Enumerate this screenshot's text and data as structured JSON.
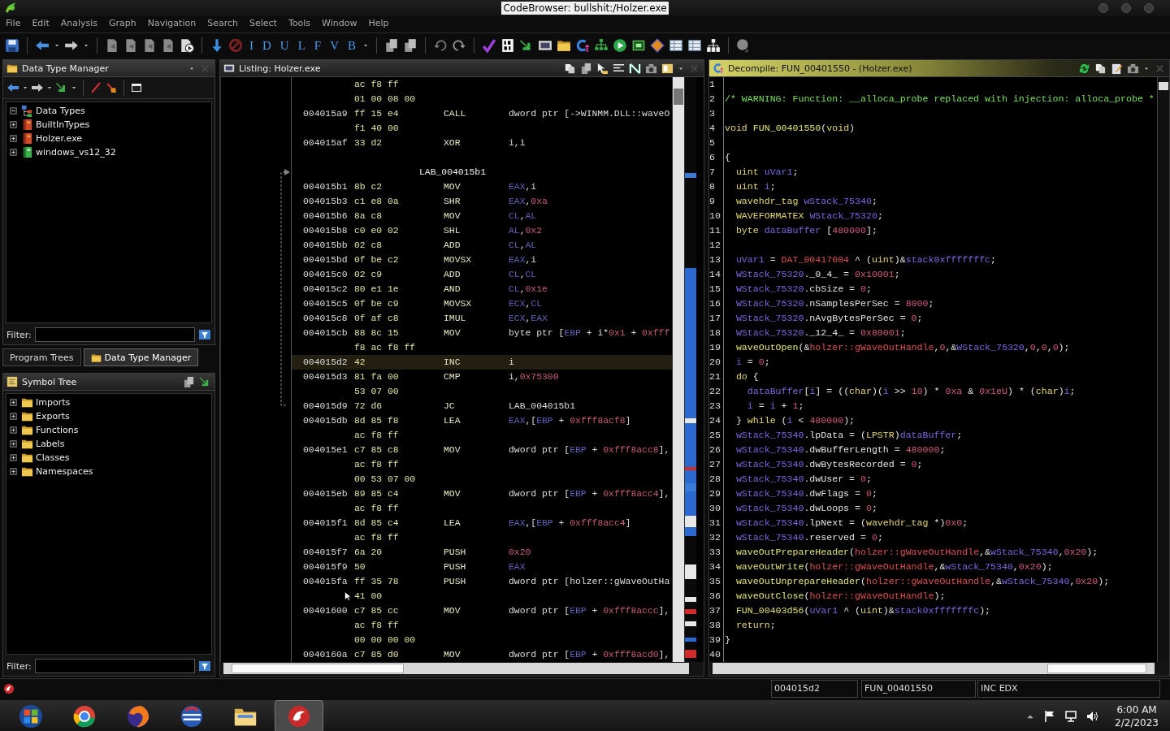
{
  "window": {
    "title": "CodeBrowser: bullshit:/Holzer.exe"
  },
  "menu": [
    "File",
    "Edit",
    "Analysis",
    "Graph",
    "Navigation",
    "Search",
    "Select",
    "Tools",
    "Window",
    "Help"
  ],
  "toolbar": {
    "letters": [
      "I",
      "D",
      "U",
      "L",
      "F",
      "V",
      "B"
    ]
  },
  "data_type_manager": {
    "title": "Data Type Manager",
    "filter_label": "Filter:",
    "tree": [
      {
        "label": "Data Types",
        "expanded": true,
        "children": [
          {
            "label": "BuiltInTypes",
            "expanded": false
          },
          {
            "label": "Holzer.exe",
            "expanded": false
          },
          {
            "label": "windows_vs12_32",
            "expanded": false
          }
        ]
      }
    ]
  },
  "left_tabs": [
    {
      "label": "Program Trees",
      "selected": false
    },
    {
      "label": "Data Type Manager",
      "selected": true
    }
  ],
  "symbol_tree": {
    "title": "Symbol Tree",
    "filter_label": "Filter:",
    "items": [
      {
        "label": "Imports",
        "expanded": false
      },
      {
        "label": "Exports",
        "expanded": false
      },
      {
        "label": "Functions",
        "expanded": false
      },
      {
        "label": "Labels",
        "expanded": false
      },
      {
        "label": "Classes",
        "expanded": false
      },
      {
        "label": "Namespaces",
        "expanded": false
      }
    ]
  },
  "listing": {
    "title": "Listing:  Holzer.exe",
    "rows": [
      {
        "kind": "code",
        "bytes": "ac f8 ff",
        "selected": false
      },
      {
        "kind": "code",
        "bytes": "01 00 08 00",
        "selected": false
      },
      {
        "kind": "code",
        "address": "004015a9",
        "bytes": "ff 15 e4",
        "mnemonic": "CALL",
        "operands": [
          {
            "text": "dword ptr [->WINMM.DLL::waveO",
            "kind": "plain"
          }
        ],
        "selected": false
      },
      {
        "kind": "code",
        "bytes": "f1 40 00",
        "selected": false
      },
      {
        "kind": "code",
        "address": "004015af",
        "bytes": "33 d2",
        "mnemonic": "XOR",
        "operands": [
          {
            "text": "i,i",
            "kind": "plain"
          }
        ],
        "selected": false
      },
      {
        "kind": "blank",
        "selected": false
      },
      {
        "kind": "label",
        "label": "LAB_004015b1",
        "selected": false
      },
      {
        "kind": "code",
        "address": "004015b1",
        "bytes": "8b c2",
        "mnemonic": "MOV",
        "operands": [
          {
            "text": "EAX",
            "kind": "register"
          },
          {
            "text": ",i",
            "kind": "plain"
          }
        ],
        "selected": false
      },
      {
        "kind": "code",
        "address": "004015b3",
        "bytes": "c1 e8 0a",
        "mnemonic": "SHR",
        "operands": [
          {
            "text": "EAX",
            "kind": "register"
          },
          {
            "text": ",",
            "kind": "plain"
          },
          {
            "text": "0xa",
            "kind": "number"
          }
        ],
        "selected": false
      },
      {
        "kind": "code",
        "address": "004015b6",
        "bytes": "8a c8",
        "mnemonic": "MOV",
        "operands": [
          {
            "text": "CL",
            "kind": "register"
          },
          {
            "text": ",",
            "kind": "plain"
          },
          {
            "text": "AL",
            "kind": "register"
          }
        ],
        "selected": false
      },
      {
        "kind": "code",
        "address": "004015b8",
        "bytes": "c0 e0 02",
        "mnemonic": "SHL",
        "operands": [
          {
            "text": "AL",
            "kind": "register"
          },
          {
            "text": ",",
            "kind": "plain"
          },
          {
            "text": "0x2",
            "kind": "number"
          }
        ],
        "selected": false
      },
      {
        "kind": "code",
        "address": "004015bb",
        "bytes": "02 c8",
        "mnemonic": "ADD",
        "operands": [
          {
            "text": "CL",
            "kind": "register"
          },
          {
            "text": ",",
            "kind": "plain"
          },
          {
            "text": "AL",
            "kind": "register"
          }
        ],
        "selected": false
      },
      {
        "kind": "code",
        "address": "004015bd",
        "bytes": "0f be c2",
        "mnemonic": "MOVSX",
        "operands": [
          {
            "text": "EAX",
            "kind": "register"
          },
          {
            "text": ",i",
            "kind": "plain"
          }
        ],
        "selected": false
      },
      {
        "kind": "code",
        "address": "004015c0",
        "bytes": "02 c9",
        "mnemonic": "ADD",
        "operands": [
          {
            "text": "CL",
            "kind": "register"
          },
          {
            "text": ",",
            "kind": "plain"
          },
          {
            "text": "CL",
            "kind": "register"
          }
        ],
        "selected": false
      },
      {
        "kind": "code",
        "address": "004015c2",
        "bytes": "80 e1 1e",
        "mnemonic": "AND",
        "operands": [
          {
            "text": "CL",
            "kind": "register"
          },
          {
            "text": ",",
            "kind": "plain"
          },
          {
            "text": "0x1e",
            "kind": "number"
          }
        ],
        "selected": false
      },
      {
        "kind": "code",
        "address": "004015c5",
        "bytes": "0f be c9",
        "mnemonic": "MOVSX",
        "operands": [
          {
            "text": "ECX",
            "kind": "register"
          },
          {
            "text": ",",
            "kind": "plain"
          },
          {
            "text": "CL",
            "kind": "register"
          }
        ],
        "selected": false
      },
      {
        "kind": "code",
        "address": "004015c8",
        "bytes": "0f af c8",
        "mnemonic": "IMUL",
        "operands": [
          {
            "text": "ECX",
            "kind": "register"
          },
          {
            "text": ",",
            "kind": "plain"
          },
          {
            "text": "EAX",
            "kind": "register"
          }
        ],
        "selected": false
      },
      {
        "kind": "code",
        "address": "004015cb",
        "bytes": "88 8c 15",
        "mnemonic": "MOV",
        "operands": [
          {
            "text": "byte ptr [",
            "kind": "plain"
          },
          {
            "text": "EBP",
            "kind": "register"
          },
          {
            "text": " + i*",
            "kind": "plain"
          },
          {
            "text": "0x1",
            "kind": "number"
          },
          {
            "text": " + ",
            "kind": "plain"
          },
          {
            "text": "0xfff",
            "kind": "number"
          }
        ],
        "selected": false
      },
      {
        "kind": "code",
        "bytes": "f8 ac f8 ff",
        "selected": false
      },
      {
        "kind": "code",
        "address": "004015d2",
        "bytes": "42",
        "mnemonic": "INC",
        "operands": [
          {
            "text": "i",
            "kind": "plain"
          }
        ],
        "selected": true
      },
      {
        "kind": "code",
        "address": "004015d3",
        "bytes": "81 fa 00",
        "mnemonic": "CMP",
        "operands": [
          {
            "text": "i,",
            "kind": "plain"
          },
          {
            "text": "0x75300",
            "kind": "number"
          }
        ],
        "selected": false
      },
      {
        "kind": "code",
        "bytes": "53 07 00",
        "selected": false
      },
      {
        "kind": "code",
        "address": "004015d9",
        "bytes": "72 d6",
        "mnemonic": "JC",
        "operands": [
          {
            "text": "LAB_004015b1",
            "kind": "plain"
          }
        ],
        "selected": false
      },
      {
        "kind": "code",
        "address": "004015db",
        "bytes": "8d 85 f8",
        "mnemonic": "LEA",
        "operands": [
          {
            "text": "EAX",
            "kind": "register"
          },
          {
            "text": ",[",
            "kind": "plain"
          },
          {
            "text": "EBP",
            "kind": "register"
          },
          {
            "text": " + ",
            "kind": "plain"
          },
          {
            "text": "0xfff8acf8",
            "kind": "number"
          },
          {
            "text": "]",
            "kind": "plain"
          }
        ],
        "selected": false
      },
      {
        "kind": "code",
        "bytes": "ac f8 ff",
        "selected": false
      },
      {
        "kind": "code",
        "address": "004015e1",
        "bytes": "c7 85 c8",
        "mnemonic": "MOV",
        "operands": [
          {
            "text": "dword ptr [",
            "kind": "plain"
          },
          {
            "text": "EBP",
            "kind": "register"
          },
          {
            "text": " + ",
            "kind": "plain"
          },
          {
            "text": "0xfff8acc8",
            "kind": "number"
          },
          {
            "text": "],",
            "kind": "plain"
          }
        ],
        "selected": false
      },
      {
        "kind": "code",
        "bytes": "ac f8 ff",
        "selected": false
      },
      {
        "kind": "code",
        "bytes": "00 53 07 00",
        "selected": false
      },
      {
        "kind": "code",
        "address": "004015eb",
        "bytes": "89 85 c4",
        "mnemonic": "MOV",
        "operands": [
          {
            "text": "dword ptr [",
            "kind": "plain"
          },
          {
            "text": "EBP",
            "kind": "register"
          },
          {
            "text": " + ",
            "kind": "plain"
          },
          {
            "text": "0xfff8acc4",
            "kind": "number"
          },
          {
            "text": "],",
            "kind": "plain"
          }
        ],
        "selected": false
      },
      {
        "kind": "code",
        "bytes": "ac f8 ff",
        "selected": false
      },
      {
        "kind": "code",
        "address": "004015f1",
        "bytes": "8d 85 c4",
        "mnemonic": "LEA",
        "operands": [
          {
            "text": "EAX",
            "kind": "register"
          },
          {
            "text": ",[",
            "kind": "plain"
          },
          {
            "text": "EBP",
            "kind": "register"
          },
          {
            "text": " + ",
            "kind": "plain"
          },
          {
            "text": "0xfff8acc4",
            "kind": "number"
          },
          {
            "text": "]",
            "kind": "plain"
          }
        ],
        "selected": false
      },
      {
        "kind": "code",
        "bytes": "ac f8 ff",
        "selected": false
      },
      {
        "kind": "code",
        "address": "004015f7",
        "bytes": "6a 20",
        "mnemonic": "PUSH",
        "operands": [
          {
            "text": "0x20",
            "kind": "number"
          }
        ],
        "selected": false
      },
      {
        "kind": "code",
        "address": "004015f9",
        "bytes": "50",
        "mnemonic": "PUSH",
        "operands": [
          {
            "text": "EAX",
            "kind": "register"
          }
        ],
        "selected": false
      },
      {
        "kind": "code",
        "address": "004015fa",
        "bytes": "ff 35 78",
        "mnemonic": "PUSH",
        "operands": [
          {
            "text": "dword ptr [holzer::gWaveOutHa",
            "kind": "plain"
          }
        ],
        "selected": false
      },
      {
        "kind": "code",
        "bytes": "41 00",
        "selected": false
      },
      {
        "kind": "code",
        "address": "00401600",
        "bytes": "c7 85 cc",
        "mnemonic": "MOV",
        "operands": [
          {
            "text": "dword ptr [",
            "kind": "plain"
          },
          {
            "text": "EBP",
            "kind": "register"
          },
          {
            "text": " + ",
            "kind": "plain"
          },
          {
            "text": "0xfff8accc",
            "kind": "number"
          },
          {
            "text": "],",
            "kind": "plain"
          }
        ],
        "selected": false
      },
      {
        "kind": "code",
        "bytes": "ac f8 ff",
        "selected": false
      },
      {
        "kind": "code",
        "bytes": "00 00 00 00",
        "selected": false
      },
      {
        "kind": "code",
        "address": "0040160a",
        "bytes": "c7 85 d0",
        "mnemonic": "MOV",
        "operands": [
          {
            "text": "dword ptr [",
            "kind": "plain"
          },
          {
            "text": "EBP",
            "kind": "register"
          },
          {
            "text": " + ",
            "kind": "plain"
          },
          {
            "text": "0xfff8acd0",
            "kind": "number"
          },
          {
            "text": "],",
            "kind": "plain"
          }
        ],
        "selected": false
      }
    ]
  },
  "decompiler": {
    "title": "Decompile: FUN_00401550 -  (Holzer.exe)",
    "lines": [
      {
        "no": "1"
      },
      {
        "no": "2",
        "code": [
          {
            "text": "/* WARNING: Function: __alloca_probe replaced with injection: alloca_probe *",
            "kind": "comment"
          }
        ]
      },
      {
        "no": "3"
      },
      {
        "no": "4",
        "code": [
          {
            "text": "void ",
            "kind": "type"
          },
          {
            "text": "FUN_00401550",
            "kind": "function"
          },
          {
            "text": "(",
            "kind": "plain"
          },
          {
            "text": "void",
            "kind": "type"
          },
          {
            "text": ")",
            "kind": "plain"
          }
        ]
      },
      {
        "no": "5"
      },
      {
        "no": "6",
        "code": [
          {
            "text": "{",
            "kind": "plain"
          }
        ]
      },
      {
        "no": "7",
        "code": [
          {
            "text": "  uint ",
            "kind": "type"
          },
          {
            "text": "uVar1",
            "kind": "variable"
          },
          {
            "text": ";",
            "kind": "plain"
          }
        ]
      },
      {
        "no": "8",
        "code": [
          {
            "text": "  uint ",
            "kind": "type"
          },
          {
            "text": "i",
            "kind": "variable"
          },
          {
            "text": ";",
            "kind": "plain"
          }
        ]
      },
      {
        "no": "9",
        "code": [
          {
            "text": "  wavehdr_tag ",
            "kind": "type"
          },
          {
            "text": "wStack_75340",
            "kind": "variable"
          },
          {
            "text": ";",
            "kind": "plain"
          }
        ]
      },
      {
        "no": "10",
        "code": [
          {
            "text": "  WAVEFORMATEX ",
            "kind": "type"
          },
          {
            "text": "WStack_75320",
            "kind": "variable"
          },
          {
            "text": ";",
            "kind": "plain"
          }
        ]
      },
      {
        "no": "11",
        "code": [
          {
            "text": "  byte ",
            "kind": "type"
          },
          {
            "text": "dataBuffer",
            "kind": "variable"
          },
          {
            "text": " [",
            "kind": "plain"
          },
          {
            "text": "480000",
            "kind": "number"
          },
          {
            "text": "];",
            "kind": "plain"
          }
        ]
      },
      {
        "no": "12"
      },
      {
        "no": "13",
        "code": [
          {
            "text": "  uVar1",
            "kind": "variable"
          },
          {
            "text": " = ",
            "kind": "plain"
          },
          {
            "text": "DAT_00417004",
            "kind": "global"
          },
          {
            "text": " ^ (",
            "kind": "plain"
          },
          {
            "text": "uint",
            "kind": "type"
          },
          {
            "text": ")&",
            "kind": "plain"
          },
          {
            "text": "stack0xfffffffc",
            "kind": "variable"
          },
          {
            "text": ";",
            "kind": "plain"
          }
        ]
      },
      {
        "no": "14",
        "code": [
          {
            "text": "  WStack_75320",
            "kind": "variable"
          },
          {
            "text": "._0_4_ = ",
            "kind": "plain"
          },
          {
            "text": "0x10001",
            "kind": "number"
          },
          {
            "text": ";",
            "kind": "plain"
          }
        ]
      },
      {
        "no": "15",
        "code": [
          {
            "text": "  WStack_75320",
            "kind": "variable"
          },
          {
            "text": ".cbSize = ",
            "kind": "plain"
          },
          {
            "text": "0",
            "kind": "number"
          },
          {
            "text": ";",
            "kind": "plain"
          }
        ]
      },
      {
        "no": "16",
        "code": [
          {
            "text": "  WStack_75320",
            "kind": "variable"
          },
          {
            "text": ".nSamplesPerSec = ",
            "kind": "plain"
          },
          {
            "text": "8000",
            "kind": "number"
          },
          {
            "text": ";",
            "kind": "plain"
          }
        ]
      },
      {
        "no": "17",
        "code": [
          {
            "text": "  WStack_75320",
            "kind": "variable"
          },
          {
            "text": ".nAvgBytesPerSec = ",
            "kind": "plain"
          },
          {
            "text": "0",
            "kind": "number"
          },
          {
            "text": ";",
            "kind": "plain"
          }
        ]
      },
      {
        "no": "18",
        "code": [
          {
            "text": "  WStack_75320",
            "kind": "variable"
          },
          {
            "text": "._12_4_ = ",
            "kind": "plain"
          },
          {
            "text": "0x80001",
            "kind": "number"
          },
          {
            "text": ";",
            "kind": "plain"
          }
        ]
      },
      {
        "no": "19",
        "code": [
          {
            "text": "  waveOutOpen",
            "kind": "function"
          },
          {
            "text": "(&",
            "kind": "plain"
          },
          {
            "text": "holzer::gWaveOutHandle",
            "kind": "global"
          },
          {
            "text": ",",
            "kind": "plain"
          },
          {
            "text": "0",
            "kind": "number"
          },
          {
            "text": ",&",
            "kind": "plain"
          },
          {
            "text": "WStack_75320",
            "kind": "variable"
          },
          {
            "text": ",",
            "kind": "plain"
          },
          {
            "text": "0",
            "kind": "number"
          },
          {
            "text": ",",
            "kind": "plain"
          },
          {
            "text": "0",
            "kind": "number"
          },
          {
            "text": ",",
            "kind": "plain"
          },
          {
            "text": "0",
            "kind": "number"
          },
          {
            "text": ");",
            "kind": "plain"
          }
        ]
      },
      {
        "no": "20",
        "code": [
          {
            "text": "  i",
            "kind": "variable"
          },
          {
            "text": " = ",
            "kind": "plain"
          },
          {
            "text": "0",
            "kind": "number"
          },
          {
            "text": ";",
            "kind": "plain"
          }
        ]
      },
      {
        "no": "21",
        "code": [
          {
            "text": "  do",
            "kind": "type"
          },
          {
            "text": " {",
            "kind": "plain"
          }
        ]
      },
      {
        "no": "22",
        "code": [
          {
            "text": "    dataBuffer",
            "kind": "variable"
          },
          {
            "text": "[",
            "kind": "plain"
          },
          {
            "text": "i",
            "kind": "variable"
          },
          {
            "text": "] = ((",
            "kind": "plain"
          },
          {
            "text": "char",
            "kind": "type"
          },
          {
            "text": ")(",
            "kind": "plain"
          },
          {
            "text": "i",
            "kind": "variable"
          },
          {
            "text": " >> ",
            "kind": "plain"
          },
          {
            "text": "10",
            "kind": "number"
          },
          {
            "text": ") * ",
            "kind": "plain"
          },
          {
            "text": "0xa",
            "kind": "number"
          },
          {
            "text": " & ",
            "kind": "plain"
          },
          {
            "text": "0x1eU",
            "kind": "number"
          },
          {
            "text": ") * (",
            "kind": "plain"
          },
          {
            "text": "char",
            "kind": "type"
          },
          {
            "text": ")",
            "kind": "plain"
          },
          {
            "text": "i",
            "kind": "variable"
          },
          {
            "text": ";",
            "kind": "plain"
          }
        ]
      },
      {
        "no": "23",
        "code": [
          {
            "text": "    i",
            "kind": "variable"
          },
          {
            "text": " = ",
            "kind": "plain"
          },
          {
            "text": "i",
            "kind": "variable"
          },
          {
            "text": " + ",
            "kind": "plain"
          },
          {
            "text": "1",
            "kind": "number"
          },
          {
            "text": ";",
            "kind": "plain"
          }
        ]
      },
      {
        "no": "24",
        "code": [
          {
            "text": "  } ",
            "kind": "plain"
          },
          {
            "text": "while",
            "kind": "type"
          },
          {
            "text": " (",
            "kind": "plain"
          },
          {
            "text": "i",
            "kind": "variable"
          },
          {
            "text": " < ",
            "kind": "plain"
          },
          {
            "text": "480000",
            "kind": "number"
          },
          {
            "text": ");",
            "kind": "plain"
          }
        ]
      },
      {
        "no": "25",
        "code": [
          {
            "text": "  wStack_75340",
            "kind": "variable"
          },
          {
            "text": ".lpData = (",
            "kind": "plain"
          },
          {
            "text": "LPSTR",
            "kind": "type"
          },
          {
            "text": ")",
            "kind": "plain"
          },
          {
            "text": "dataBuffer",
            "kind": "variable"
          },
          {
            "text": ";",
            "kind": "plain"
          }
        ]
      },
      {
        "no": "26",
        "code": [
          {
            "text": "  wStack_75340",
            "kind": "variable"
          },
          {
            "text": ".dwBufferLength = ",
            "kind": "plain"
          },
          {
            "text": "480000",
            "kind": "number"
          },
          {
            "text": ";",
            "kind": "plain"
          }
        ]
      },
      {
        "no": "27",
        "code": [
          {
            "text": "  wStack_75340",
            "kind": "variable"
          },
          {
            "text": ".dwBytesRecorded = ",
            "kind": "plain"
          },
          {
            "text": "0",
            "kind": "number"
          },
          {
            "text": ";",
            "kind": "plain"
          }
        ]
      },
      {
        "no": "28",
        "code": [
          {
            "text": "  wStack_75340",
            "kind": "variable"
          },
          {
            "text": ".dwUser = ",
            "kind": "plain"
          },
          {
            "text": "0",
            "kind": "number"
          },
          {
            "text": ";",
            "kind": "plain"
          }
        ]
      },
      {
        "no": "29",
        "code": [
          {
            "text": "  wStack_75340",
            "kind": "variable"
          },
          {
            "text": ".dwFlags = ",
            "kind": "plain"
          },
          {
            "text": "0",
            "kind": "number"
          },
          {
            "text": ";",
            "kind": "plain"
          }
        ]
      },
      {
        "no": "30",
        "code": [
          {
            "text": "  wStack_75340",
            "kind": "variable"
          },
          {
            "text": ".dwLoops = ",
            "kind": "plain"
          },
          {
            "text": "0",
            "kind": "number"
          },
          {
            "text": ";",
            "kind": "plain"
          }
        ]
      },
      {
        "no": "31",
        "code": [
          {
            "text": "  wStack_75340",
            "kind": "variable"
          },
          {
            "text": ".lpNext = (",
            "kind": "plain"
          },
          {
            "text": "wavehdr_tag",
            "kind": "type"
          },
          {
            "text": " *)",
            "kind": "plain"
          },
          {
            "text": "0x0",
            "kind": "number"
          },
          {
            "text": ";",
            "kind": "plain"
          }
        ]
      },
      {
        "no": "32",
        "code": [
          {
            "text": "  wStack_75340",
            "kind": "variable"
          },
          {
            "text": ".reserved = ",
            "kind": "plain"
          },
          {
            "text": "0",
            "kind": "number"
          },
          {
            "text": ";",
            "kind": "plain"
          }
        ]
      },
      {
        "no": "33",
        "code": [
          {
            "text": "  waveOutPrepareHeader",
            "kind": "function"
          },
          {
            "text": "(",
            "kind": "plain"
          },
          {
            "text": "holzer::gWaveOutHandle",
            "kind": "global"
          },
          {
            "text": ",&",
            "kind": "plain"
          },
          {
            "text": "wStack_75340",
            "kind": "variable"
          },
          {
            "text": ",",
            "kind": "plain"
          },
          {
            "text": "0x20",
            "kind": "number"
          },
          {
            "text": ");",
            "kind": "plain"
          }
        ]
      },
      {
        "no": "34",
        "code": [
          {
            "text": "  waveOutWrite",
            "kind": "function"
          },
          {
            "text": "(",
            "kind": "plain"
          },
          {
            "text": "holzer::gWaveOutHandle",
            "kind": "global"
          },
          {
            "text": ",&",
            "kind": "plain"
          },
          {
            "text": "wStack_75340",
            "kind": "variable"
          },
          {
            "text": ",",
            "kind": "plain"
          },
          {
            "text": "0x20",
            "kind": "number"
          },
          {
            "text": ");",
            "kind": "plain"
          }
        ]
      },
      {
        "no": "35",
        "code": [
          {
            "text": "  waveOutUnprepareHeader",
            "kind": "function"
          },
          {
            "text": "(",
            "kind": "plain"
          },
          {
            "text": "holzer::gWaveOutHandle",
            "kind": "global"
          },
          {
            "text": ",&",
            "kind": "plain"
          },
          {
            "text": "wStack_75340",
            "kind": "variable"
          },
          {
            "text": ",",
            "kind": "plain"
          },
          {
            "text": "0x20",
            "kind": "number"
          },
          {
            "text": ");",
            "kind": "plain"
          }
        ]
      },
      {
        "no": "36",
        "code": [
          {
            "text": "  waveOutClose",
            "kind": "function"
          },
          {
            "text": "(",
            "kind": "plain"
          },
          {
            "text": "holzer::gWaveOutHandle",
            "kind": "global"
          },
          {
            "text": ");",
            "kind": "plain"
          }
        ]
      },
      {
        "no": "37",
        "code": [
          {
            "text": "  FUN_00403d56",
            "kind": "function"
          },
          {
            "text": "(",
            "kind": "plain"
          },
          {
            "text": "uVar1",
            "kind": "variable"
          },
          {
            "text": " ^ (",
            "kind": "plain"
          },
          {
            "text": "uint",
            "kind": "type"
          },
          {
            "text": ")&",
            "kind": "plain"
          },
          {
            "text": "stack0xfffffffc",
            "kind": "variable"
          },
          {
            "text": ");",
            "kind": "plain"
          }
        ]
      },
      {
        "no": "38",
        "code": [
          {
            "text": "  return",
            "kind": "type"
          },
          {
            "text": ";",
            "kind": "plain"
          }
        ]
      },
      {
        "no": "39",
        "code": [
          {
            "text": "}",
            "kind": "plain"
          }
        ]
      },
      {
        "no": "40"
      }
    ]
  },
  "status_bar": {
    "fields": [
      "004015d2",
      "FUN_00401550",
      "INC EDX"
    ]
  },
  "taskbar": {
    "apps": [
      {
        "selected": false
      },
      {
        "selected": false
      },
      {
        "selected": false
      },
      {
        "selected": false
      },
      {
        "selected": false
      },
      {
        "selected": true
      }
    ],
    "time": "6:00 AM",
    "date": "2/2/2023"
  }
}
